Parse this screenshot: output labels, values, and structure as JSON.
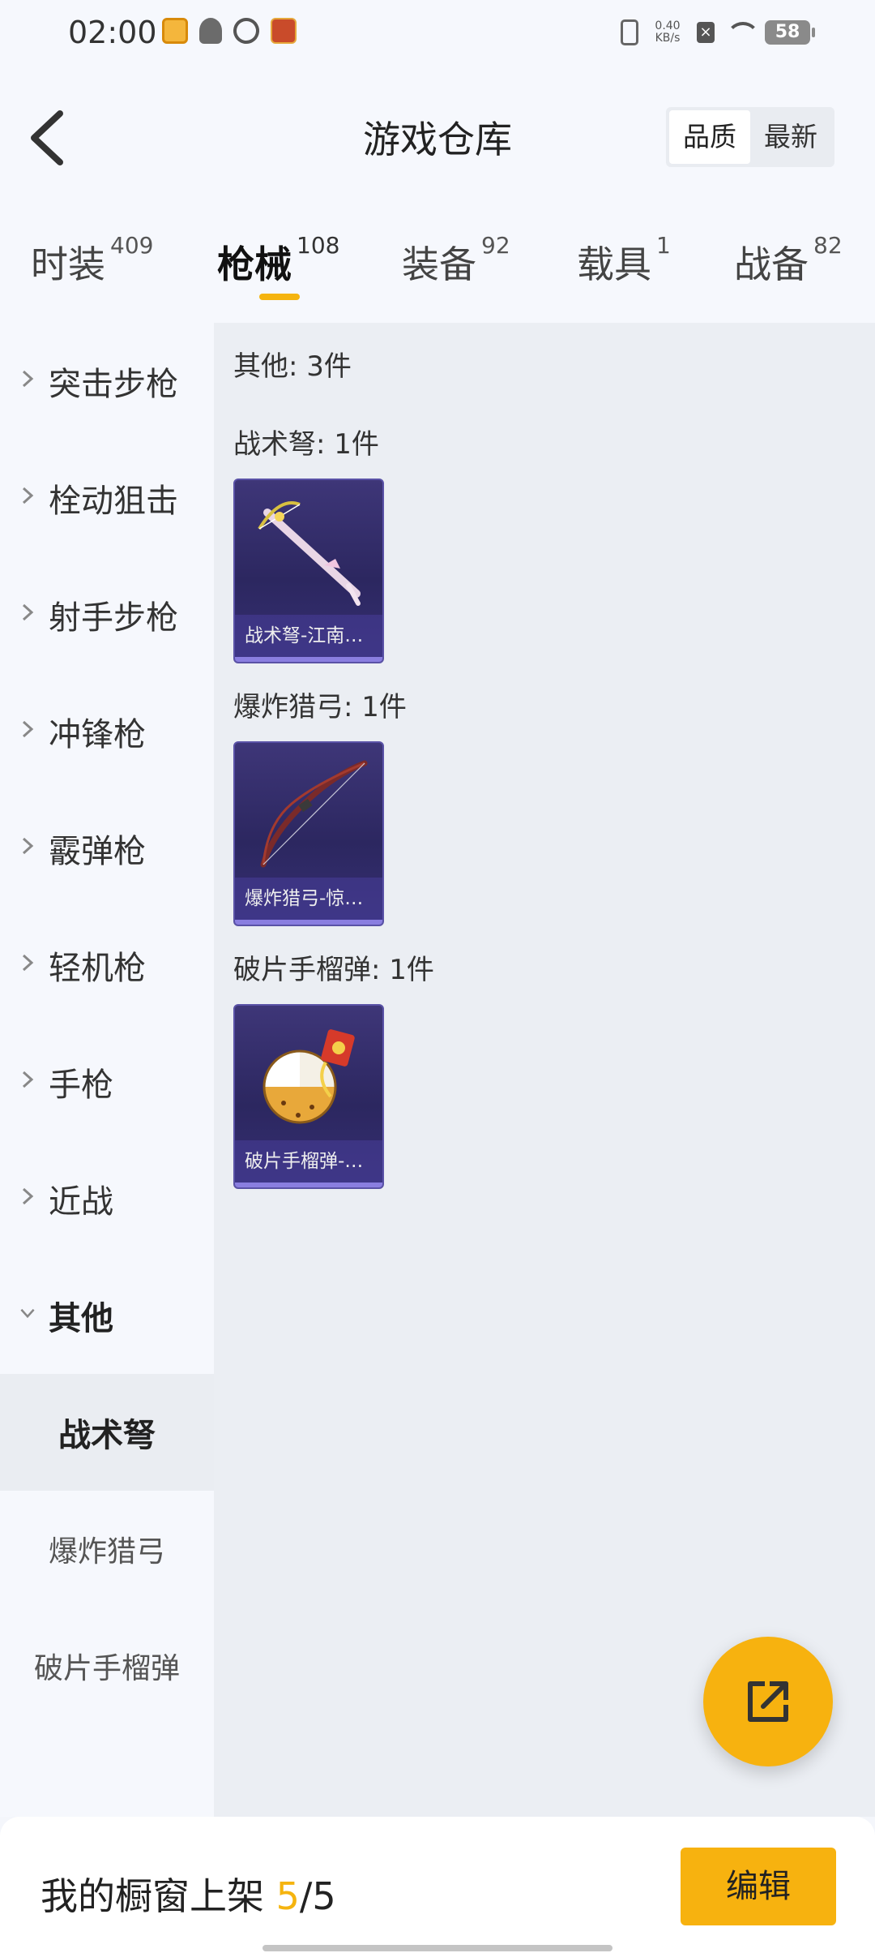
{
  "status_bar": {
    "time": "02:00",
    "net_speed_value": "0.40",
    "net_speed_unit": "KB/s",
    "battery": "58"
  },
  "header": {
    "title": "游戏仓库",
    "sort_options": [
      "品质",
      "最新"
    ],
    "sort_selected": "品质"
  },
  "tabs": [
    {
      "label": "时装",
      "count": "409"
    },
    {
      "label": "枪械",
      "count": "108"
    },
    {
      "label": "装备",
      "count": "92"
    },
    {
      "label": "载具",
      "count": "1"
    },
    {
      "label": "战备",
      "count": "82"
    }
  ],
  "active_tab": "枪械",
  "sidebar": {
    "items": [
      {
        "label": "突击步枪"
      },
      {
        "label": "栓动狙击"
      },
      {
        "label": "射手步枪"
      },
      {
        "label": "冲锋枪"
      },
      {
        "label": "霰弹枪"
      },
      {
        "label": "轻机枪"
      },
      {
        "label": "手枪"
      },
      {
        "label": "近战"
      },
      {
        "label": "其他"
      }
    ],
    "expanded": "其他",
    "sub_items": [
      {
        "label": "战术弩"
      },
      {
        "label": "爆炸猎弓"
      },
      {
        "label": "破片手榴弹"
      }
    ],
    "active_sub": "战术弩"
  },
  "content": {
    "summary": "其他: 3件",
    "groups": [
      {
        "heading": "战术弩: 1件",
        "item_caption": "战术弩-江南…"
      },
      {
        "heading": "爆炸猎弓: 1件",
        "item_caption": "爆炸猎弓-惊…"
      },
      {
        "heading": "破片手榴弹: 1件",
        "item_caption": "破片手榴弹-…"
      }
    ]
  },
  "bottom_bar": {
    "shelf_label": "我的橱窗上架 ",
    "shelf_count": "5",
    "shelf_total": "/5",
    "edit_label": "编辑"
  },
  "colors": {
    "accent": "#f7b20f",
    "card_bg": "#2c2760"
  },
  "icons": {
    "back": "chevron-left-icon",
    "fab": "share-external-icon"
  }
}
